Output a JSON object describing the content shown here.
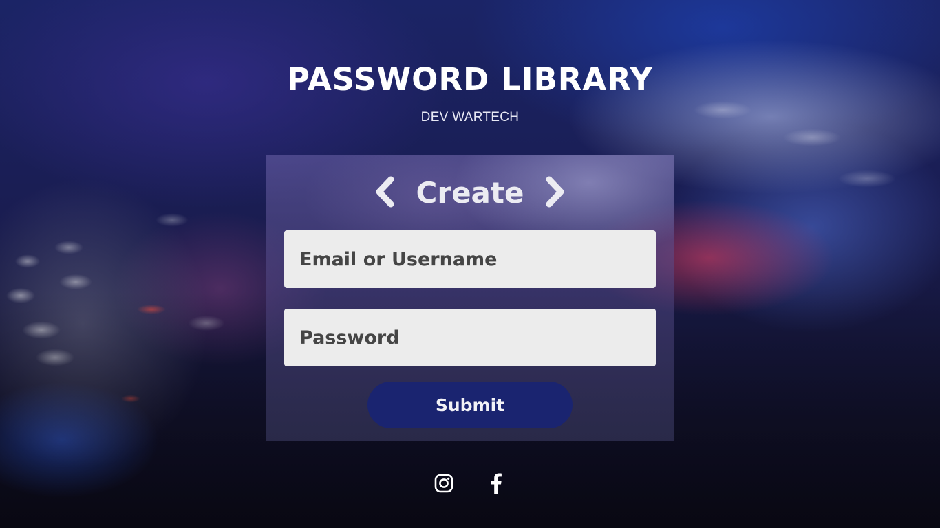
{
  "header": {
    "title": "PASSWORD LIBRARY",
    "subtitle": "DEV WARTECH"
  },
  "form": {
    "heading": "Create",
    "email_placeholder": "Email or Username",
    "password_placeholder": "Password",
    "submit_label": "Submit",
    "prev_icon": "chevron-left-icon",
    "next_icon": "chevron-right-icon"
  },
  "social": {
    "icons": [
      "instagram-icon",
      "facebook-icon"
    ]
  },
  "colors": {
    "submit_bg": "#1a2470",
    "field_bg": "#ececec",
    "field_text": "#454545"
  }
}
